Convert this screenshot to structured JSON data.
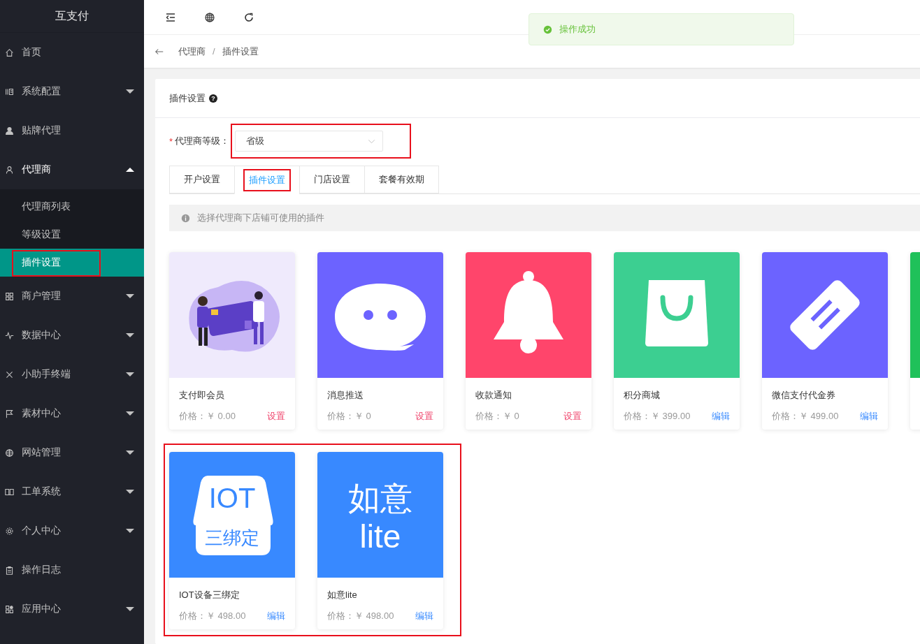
{
  "sidebar": {
    "logo": "互支付",
    "items": [
      {
        "label": "首页",
        "kind": "link"
      },
      {
        "label": "系统配置",
        "kind": "group",
        "expanded": false
      },
      {
        "label": "贴牌代理",
        "kind": "link"
      },
      {
        "label": "代理商",
        "kind": "group",
        "expanded": true,
        "children": [
          {
            "label": "代理商列表",
            "selected": false,
            "highlighted": false
          },
          {
            "label": "等级设置",
            "selected": false,
            "highlighted": false
          },
          {
            "label": "插件设置",
            "selected": true,
            "highlighted": true
          }
        ]
      },
      {
        "label": "商户管理",
        "kind": "group",
        "expanded": false
      },
      {
        "label": "数据中心",
        "kind": "group",
        "expanded": false
      },
      {
        "label": "小助手终端",
        "kind": "group",
        "expanded": false
      },
      {
        "label": "素材中心",
        "kind": "group",
        "expanded": false
      },
      {
        "label": "网站管理",
        "kind": "group",
        "expanded": false
      },
      {
        "label": "工单系统",
        "kind": "group",
        "expanded": false
      },
      {
        "label": "个人中心",
        "kind": "group",
        "expanded": false
      },
      {
        "label": "操作日志",
        "kind": "link"
      },
      {
        "label": "应用中心",
        "kind": "group",
        "expanded": false
      }
    ]
  },
  "toast": {
    "text": "操作成功"
  },
  "breadcrumb": [
    "代理商",
    "插件设置"
  ],
  "breadcrumb_separator": "/",
  "panel": {
    "title": "插件设置",
    "help_icon": "?"
  },
  "level_field": {
    "required_mark": "*",
    "label": "代理商等级：",
    "value": "省级",
    "highlighted": true
  },
  "tabs": [
    {
      "label": "开户设置",
      "selected": false,
      "highlighted": false
    },
    {
      "label": "插件设置",
      "selected": true,
      "highlighted": true
    },
    {
      "label": "门店设置",
      "selected": false,
      "highlighted": false
    },
    {
      "label": "套餐有效期",
      "selected": false,
      "highlighted": false
    }
  ],
  "info": "选择代理商下店铺可使用的插件",
  "card_rows": [
    {
      "highlighted": false,
      "cards": [
        {
          "kind": "setup",
          "name": "支付即会员",
          "price": "价格：￥ 0.00",
          "action": "设置",
          "color": "#efeafc"
        },
        {
          "kind": "setup",
          "name": "消息推送",
          "price": "价格：￥ 0",
          "action": "设置",
          "color": "#6c63ff"
        },
        {
          "kind": "setup",
          "name": "收款通知",
          "price": "价格：￥ 0",
          "action": "设置",
          "color": "#ff456b"
        },
        {
          "kind": "edit",
          "name": "积分商城",
          "price": "价格：￥ 399.00",
          "action": "编辑",
          "color": "#3ccf91"
        },
        {
          "kind": "edit",
          "name": "微信支付代金券",
          "price": "价格：￥ 499.00",
          "action": "编辑",
          "color": "#6c63ff"
        },
        {
          "kind": "partial",
          "color": "#1fc15a"
        }
      ]
    },
    {
      "highlighted": true,
      "cards": [
        {
          "kind": "edit",
          "name": "IOT设备三绑定",
          "price": "价格：￥ 498.00",
          "action": "编辑",
          "color": "#3889ff",
          "logo_text": [
            "IOT",
            "三绑定"
          ]
        },
        {
          "kind": "edit",
          "name": "如意lite",
          "price": "价格：￥ 498.00",
          "action": "编辑",
          "color": "#3889ff",
          "logo_text": [
            "如意",
            "lite"
          ]
        }
      ]
    }
  ]
}
